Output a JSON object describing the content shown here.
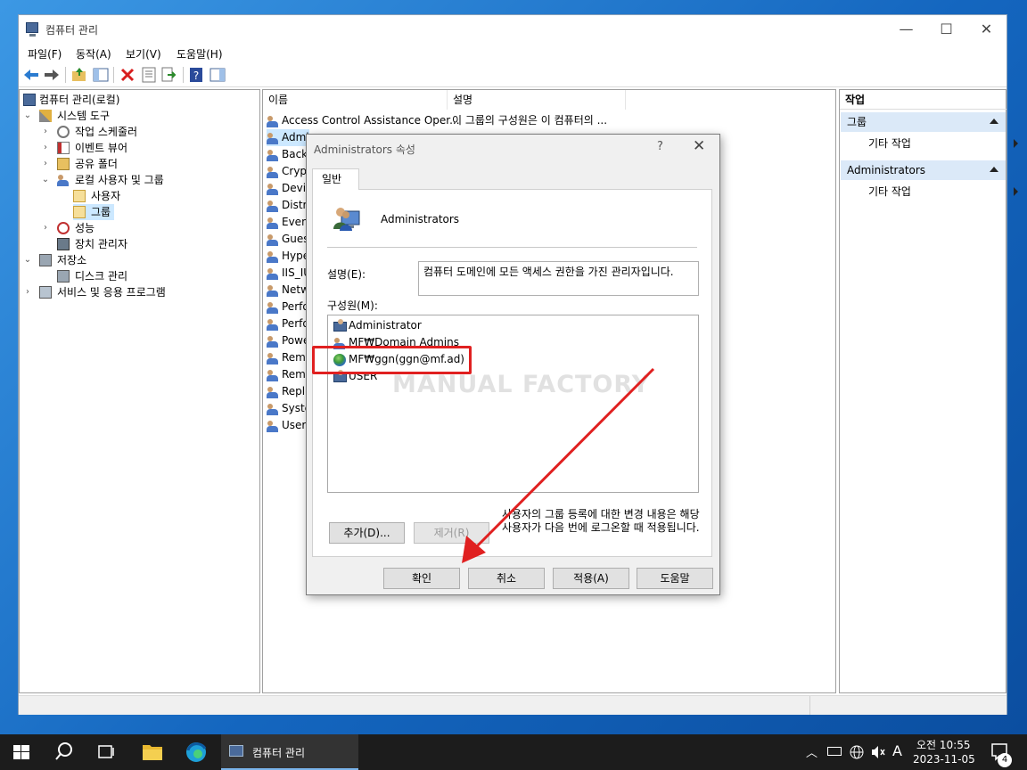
{
  "window": {
    "title": "컴퓨터 관리",
    "controls": {
      "minimize": "—",
      "maximize": "☐",
      "close": "✕"
    }
  },
  "menu": [
    "파일(F)",
    "동작(A)",
    "보기(V)",
    "도움말(H)"
  ],
  "tree": {
    "root": "컴퓨터 관리(로컬)",
    "system_tools": "시스템 도구",
    "task_scheduler": "작업 스케줄러",
    "event_viewer": "이벤트 뷰어",
    "shared_folders": "공유 폴더",
    "local_users": "로컬 사용자 및 그룹",
    "users": "사용자",
    "groups": "그룹",
    "performance": "성능",
    "device_manager": "장치 관리자",
    "storage": "저장소",
    "disk_management": "디스크 관리",
    "services": "서비스 및 응용 프로그램"
  },
  "list": {
    "col_name": "이름",
    "col_desc": "설명",
    "rows": [
      {
        "name": "Access Control Assistance Oper...",
        "desc": "이 그룹의 구성원은 이 컴퓨터의 ..."
      },
      {
        "name": "Admi",
        "desc": ""
      },
      {
        "name": "Back",
        "desc": ""
      },
      {
        "name": "Cryp",
        "desc": ""
      },
      {
        "name": "Devic",
        "desc": ""
      },
      {
        "name": "Distr",
        "desc": ""
      },
      {
        "name": "Even",
        "desc": ""
      },
      {
        "name": "Gues",
        "desc": ""
      },
      {
        "name": "Hype",
        "desc": ""
      },
      {
        "name": "IIS_IU",
        "desc": ""
      },
      {
        "name": "Netw",
        "desc": ""
      },
      {
        "name": "Perfo",
        "desc": ""
      },
      {
        "name": "Perfo",
        "desc": ""
      },
      {
        "name": "Powe",
        "desc": ""
      },
      {
        "name": "Remo",
        "desc": ""
      },
      {
        "name": "Remo",
        "desc": ""
      },
      {
        "name": "Repli",
        "desc": ""
      },
      {
        "name": "Syste",
        "desc": ""
      },
      {
        "name": "Users",
        "desc": ""
      }
    ]
  },
  "actions": {
    "title": "작업",
    "section1": "그룹",
    "section1_item": "기타 작업",
    "section2": "Administrators",
    "section2_item": "기타 작업"
  },
  "dialog": {
    "title": "Administrators 속성",
    "help": "?",
    "close": "✕",
    "tab": "일반",
    "group_name": "Administrators",
    "desc_label": "설명(E):",
    "desc_value": "컴퓨터 도메인에 모든 액세스 권한을 가진 관리자입니다.",
    "members_label": "구성원(M):",
    "members": [
      "Administrator",
      "MF₩Domain Admins",
      "MF₩ggn(ggn@mf.ad)",
      "USER"
    ],
    "add_button": "추가(D)...",
    "remove_button": "제거(R)",
    "hint": "사용자의 그룹 등록에 대한 변경 내용은 해당 사용자가 다음 번에 로그온할 때 적용됩니다.",
    "ok": "확인",
    "cancel": "취소",
    "apply": "적용(A)",
    "help_button": "도움말"
  },
  "watermark": "MANUAL FACTORY",
  "taskbar": {
    "app_label": "컴퓨터 관리",
    "ime": "A",
    "time": "오전 10:55",
    "date": "2023-11-05",
    "notifications": "4"
  },
  "colors": {
    "highlight": "#e02020",
    "accent": "#0078d7",
    "selection": "#cce8ff"
  }
}
